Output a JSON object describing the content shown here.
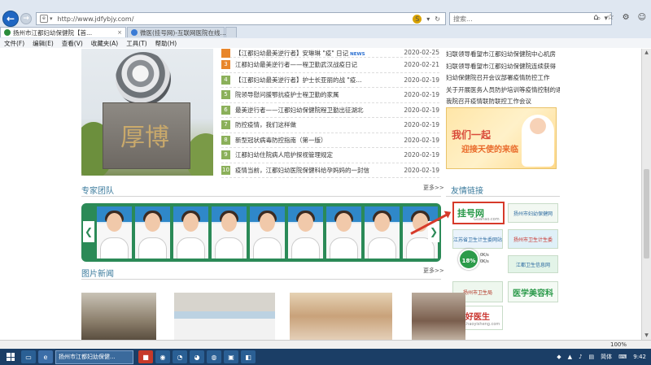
{
  "browser": {
    "url": "http://www.jdfybjy.com/",
    "search_placeholder": "搜索...",
    "tabs": [
      {
        "label": "扬州市江都妇幼保健院【首...",
        "active": true
      },
      {
        "label": "微医(挂号网)-互联网医院在线...",
        "active": false
      }
    ],
    "menu": [
      "文件(F)",
      "编辑(E)",
      "查看(V)",
      "收藏夹(A)",
      "工具(T)",
      "帮助(H)"
    ],
    "zoom": "100%"
  },
  "news": [
    {
      "num": "",
      "title": "【江都妇幼最美逆行者】安琳琳 \"疫\" 日记",
      "badge": "NEWS",
      "date": "2020-02-25"
    },
    {
      "num": "3",
      "title": "江都妇幼最美逆行者——程卫勤武汉战疫日记",
      "badge": "",
      "date": "2020-02-21"
    },
    {
      "num": "4",
      "title": "【江都妇幼最美逆行者】护士长亚丽的战 \"疫...",
      "badge": "",
      "date": "2020-02-19"
    },
    {
      "num": "5",
      "title": "院领导慰问援鄂抗疫护士程卫勤的家属",
      "badge": "",
      "date": "2020-02-19"
    },
    {
      "num": "6",
      "title": "最美逆行者——江都妇幼保健院程卫勤出征湖北",
      "badge": "",
      "date": "2020-02-19"
    },
    {
      "num": "7",
      "title": "防控疫情，我们这样做",
      "badge": "",
      "date": "2020-02-19"
    },
    {
      "num": "8",
      "title": "新型冠状病毒防控指南（第一版）",
      "badge": "",
      "date": "2020-02-19"
    },
    {
      "num": "9",
      "title": "江都妇幼住院病人陪护探视管理规定",
      "badge": "",
      "date": "2020-02-19"
    },
    {
      "num": "10",
      "title": "疫情当前，江都妇幼医院保健科给孕妈妈的一封信",
      "badge": "",
      "date": "2020-02-19"
    }
  ],
  "right_links": [
    "妇联领导看望市江都妇幼保健院中心机房",
    "妇联领导看望市江都妇幼保健院连续获得",
    "妇幼保健院召开会议部署疫情防控工作",
    "关于开展医务人员防护培训等疫情控制的通知",
    "我院召开疫情联防联控工作会议"
  ],
  "banner": {
    "line1": "我们一起",
    "line2": "迎接天使的来临"
  },
  "sections": {
    "experts": "专家团队",
    "friends": "友情链接",
    "pic_news": "图片新闻",
    "more": "更多>>"
  },
  "experts_arrow_left": "❮",
  "experts_arrow_right": "❯",
  "friend_links": {
    "guahao": "挂号网",
    "guahao_sub": "Guahao.com",
    "yangzhou_fuyou": "扬州市妇幼保健网",
    "jiangsu_health": "江苏省卫生计生委网站",
    "yangzhou_health": "扬州市卫生计生委",
    "jiangdu_health": "江都卫生信息网",
    "yangzhou_weisheng": "扬州市卫生局",
    "yixue_meirong": "医学美容科",
    "hao_yisheng": "好医生",
    "hao_yisheng_url": "www.haoyisheng.com",
    "speed_pct": "18%",
    "speed_up": "0K/s",
    "speed_down": "0K/s"
  },
  "taskbar": {
    "active_app": "扬州市江都妇幼保健...",
    "tray_lang": "简体",
    "time": "9:42"
  }
}
